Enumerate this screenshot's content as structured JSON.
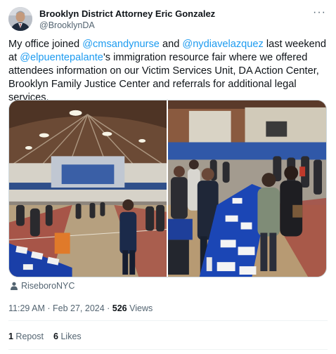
{
  "author": {
    "display_name": "Brooklyn District Attorney Eric Gonzalez",
    "handle": "@BrooklynDA",
    "avatar_icon": "profile-photo"
  },
  "more_icon": "more-icon",
  "tweet": {
    "t0": "My office joined ",
    "m1": "@cmsandynurse",
    "t1": " and ",
    "m2": "@nydiavelazquez",
    "t2": " last weekend at ",
    "m3": "@elpuentepalante",
    "t3": "'s immigration resource fair where we offered attendees information on our Victim Services Unit, DA Action Center, Brooklyn Family Justice Center and referrals for additional legal services."
  },
  "location": {
    "icon": "person-icon",
    "label": "RiseboroNYC"
  },
  "meta": {
    "time": "11:29 AM",
    "sep": " · ",
    "date": "Feb 27, 2024",
    "views_count": "526",
    "views_label": " Views"
  },
  "stats": {
    "reposts_count": "1",
    "reposts_label": " Repost",
    "likes_count": "6",
    "likes_label": " Likes"
  },
  "colors": {
    "mention": "#1d9bf0",
    "secondary": "#536471",
    "text": "#0f1419"
  }
}
